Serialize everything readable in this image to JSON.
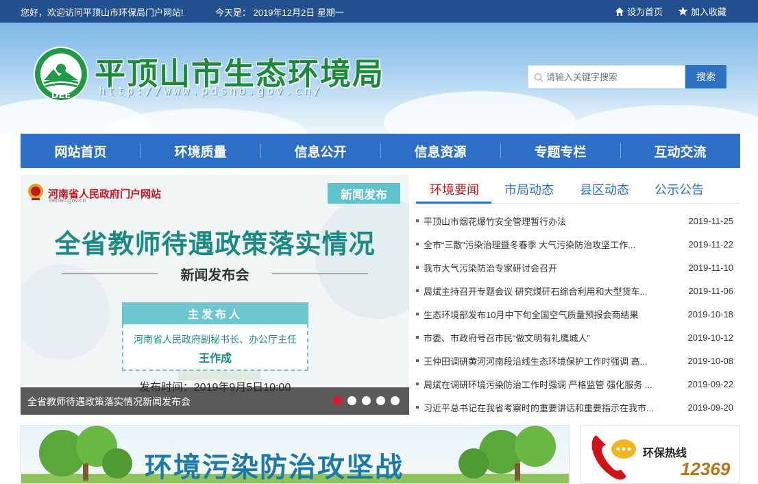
{
  "topbar": {
    "welcome": "您好，欢迎访问平顶山市环保局门户网站!",
    "today": "今天是： 2019年12月2日 星期一",
    "set_home": "设为首页",
    "add_favorite": "加入收藏"
  },
  "header": {
    "title": "平顶山市生态环境局",
    "url": "http://www.pdshb.gov.cn/",
    "logo_text": "DEE",
    "search_placeholder": "请输入关键字搜索",
    "search_button": "搜索"
  },
  "nav": [
    {
      "label": "网站首页"
    },
    {
      "label": "环境质量"
    },
    {
      "label": "信息公开"
    },
    {
      "label": "信息资源"
    },
    {
      "label": "专题专栏"
    },
    {
      "label": "互动交流"
    }
  ],
  "slider": {
    "gov_name": "河南省人民政府门户网站",
    "gov_domain": "henan.gov.cn",
    "tag": "新闻发布",
    "headline": "全省教师待遇政策落实情况",
    "subheadline": "新闻发布会",
    "panel_header": "主发布人",
    "panel_role": "河南省人民政府副秘书长、办公厅主任",
    "panel_person": "王作成",
    "time": "发布时间：2019年9月5日10:00",
    "caption": "全省教师待遇政策落实情况新闻发布会",
    "active_slide": 1,
    "slide_count": 5
  },
  "news": {
    "tabs": [
      "环境要闻",
      "市局动态",
      "县区动态",
      "公示公告"
    ],
    "items": [
      {
        "title": "平顶山市烟花爆竹安全管理暂行办法",
        "date": "2019-11-25"
      },
      {
        "title": "全市“三散”污染治理暨冬春季 大气污染防治攻坚工作...",
        "date": "2019-11-22"
      },
      {
        "title": "我市大气污染防治专家研讨会召开",
        "date": "2019-11-10"
      },
      {
        "title": "周斌主持召开专题会议 研究煤矸石综合利用和大型货车...",
        "date": "2019-11-06"
      },
      {
        "title": "生态环境部发布10月中下旬全国空气质量预报会商结果",
        "date": "2019-10-18"
      },
      {
        "title": "市委、市政府号召市民“做文明有礼鹰城人”",
        "date": "2019-10-12"
      },
      {
        "title": "王仲田调研黄河河南段沿线生态环境保护工作时强调 高...",
        "date": "2019-10-08"
      },
      {
        "title": "周斌在调研环境污染防治工作时强调 严格监管 强化服务 ...",
        "date": "2019-09-22"
      },
      {
        "title": "习近平总书记在我省考察时的重要讲话和重要指示在我市...",
        "date": "2019-09-20"
      }
    ]
  },
  "banner": {
    "text": "环境污染防治攻坚战"
  },
  "hotline": {
    "label": "环保热线",
    "number": "12369"
  },
  "colors": {
    "topbar": "#214f8f",
    "nav": "#2d6fc6",
    "accent_red": "#c8161d",
    "brand_green": "#1c8a3a"
  }
}
